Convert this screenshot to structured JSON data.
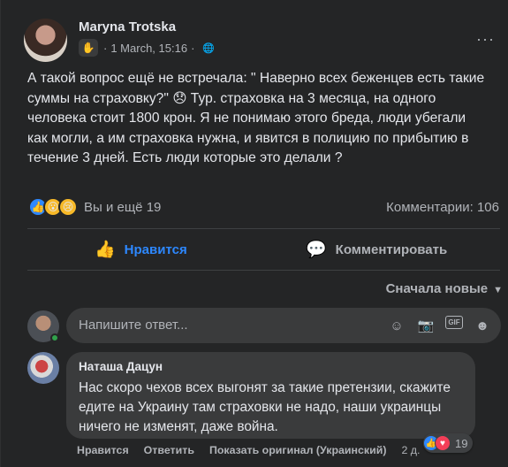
{
  "post": {
    "author": "Maryna Trotska",
    "badge_icon": "waving-hand-icon",
    "date": "1 March, 15:16",
    "audience_icon": "globe-icon",
    "text": "А такой вопрос ещё не встречала: \" Наверно всех беженцев есть такие суммы на страховку?\" 😞 Тур. страховка на 3 месяца, на одного человека стоит 1800 крон. Я не понимаю этого бреда, люди убегали как могли, а им страховка нужна, и явится в полицию по прибытию в течение 3 дней. Есть люди которые это делали ?",
    "reactions_text": "Вы и ещё 19",
    "comments_count": "Комментарии: 106",
    "more_icon": "···"
  },
  "actions": {
    "like_label": "Нравится",
    "comment_label": "Комментировать"
  },
  "sort": {
    "label": "Сначала новые"
  },
  "reply": {
    "placeholder": "Напишите ответ..."
  },
  "comment": {
    "author": "Наташа Дацун",
    "text": "Нас скоро чехов всех выгонят за такие претензии, скажите едите на Украину там страховки не надо, наши украинцы ничего не изменят, даже война.",
    "reaction_count": "19",
    "like_label": "Нравится",
    "reply_label": "Ответить",
    "translate_label": "Показать оригинал (Украинский)",
    "time": "2 д."
  },
  "colors": {
    "accent": "#2d88ff",
    "background": "#242526",
    "bubble": "#3a3b3c",
    "online": "#31a24c"
  }
}
